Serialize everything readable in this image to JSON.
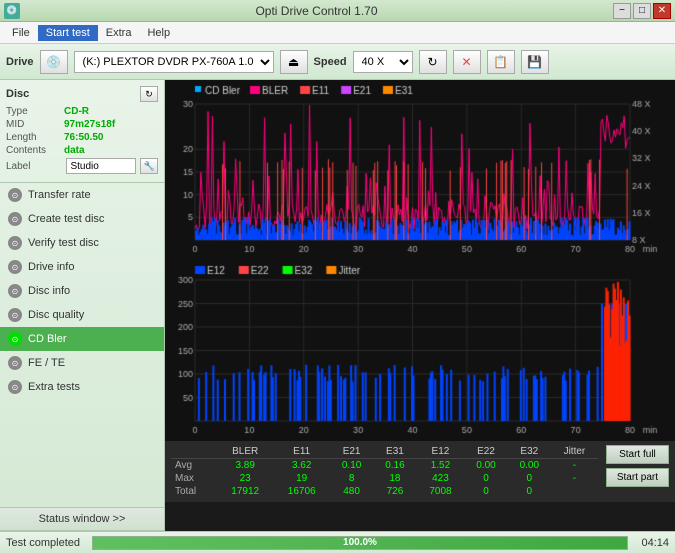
{
  "window": {
    "title": "Opti Drive Control 1.70",
    "icon": "💿"
  },
  "titlebar_buttons": {
    "minimize": "−",
    "maximize": "□",
    "close": "✕"
  },
  "menubar": {
    "items": [
      "File",
      "Start test",
      "Extra",
      "Help"
    ]
  },
  "toolbar": {
    "drive_label": "Drive",
    "drive_value": "(K:)  PLEXTOR DVDR  PX-760A 1.07",
    "speed_label": "Speed",
    "speed_value": "40 X"
  },
  "disc": {
    "title": "Disc",
    "type_label": "Type",
    "type_value": "CD-R",
    "mid_label": "MID",
    "mid_value": "97m27s18f",
    "length_label": "Length",
    "length_value": "76:50.50",
    "contents_label": "Contents",
    "contents_value": "data",
    "label_label": "Label",
    "label_value": "Studio"
  },
  "sidebar_items": [
    {
      "id": "transfer-rate",
      "label": "Transfer rate",
      "active": false
    },
    {
      "id": "create-test-disc",
      "label": "Create test disc",
      "active": false
    },
    {
      "id": "verify-test-disc",
      "label": "Verify test disc",
      "active": false
    },
    {
      "id": "drive-info",
      "label": "Drive info",
      "active": false
    },
    {
      "id": "disc-info",
      "label": "Disc info",
      "active": false
    },
    {
      "id": "disc-quality",
      "label": "Disc quality",
      "active": false
    },
    {
      "id": "cd-bler",
      "label": "CD Bler",
      "active": true
    },
    {
      "id": "fe-te",
      "label": "FE / TE",
      "active": false
    },
    {
      "id": "extra-tests",
      "label": "Extra tests",
      "active": false
    }
  ],
  "status_window_btn": "Status window >>",
  "chart1": {
    "title": "CD Bler",
    "legend": [
      {
        "label": "BLER",
        "color": "#ff0080"
      },
      {
        "label": "E11",
        "color": "#ff4444"
      },
      {
        "label": "E21",
        "color": "#cc44ff"
      },
      {
        "label": "E31",
        "color": "#ff8800"
      }
    ],
    "y_max": 30,
    "y_labels": [
      "30",
      "20",
      "15",
      "10",
      "5"
    ],
    "x_max": 80,
    "right_labels": [
      "48 X",
      "40 X",
      "32 X",
      "24 X",
      "16 X",
      "8 X"
    ],
    "x_unit": "min"
  },
  "chart2": {
    "legend": [
      {
        "label": "E12",
        "color": "#00aaff"
      },
      {
        "label": "E22",
        "color": "#ff4444"
      },
      {
        "label": "E32",
        "color": "#00ff00"
      },
      {
        "label": "Jitter",
        "color": "#ff8800"
      }
    ],
    "y_max": 300,
    "y_labels": [
      "300",
      "250",
      "200",
      "150",
      "100",
      "50"
    ],
    "x_max": 80,
    "x_unit": "min"
  },
  "stats": {
    "columns": [
      "",
      "BLER",
      "E11",
      "E21",
      "E31",
      "E12",
      "E22",
      "E32",
      "Jitter"
    ],
    "rows": [
      {
        "label": "Avg",
        "values": [
          "3.89",
          "3.62",
          "0.10",
          "0.16",
          "1.52",
          "0.00",
          "0.00",
          "-"
        ]
      },
      {
        "label": "Max",
        "values": [
          "23",
          "19",
          "8",
          "18",
          "423",
          "0",
          "0",
          "-"
        ]
      },
      {
        "label": "Total",
        "values": [
          "17912",
          "16706",
          "480",
          "726",
          "7008",
          "0",
          "0",
          ""
        ]
      }
    ],
    "btn_full": "Start full",
    "btn_part": "Start part"
  },
  "progress": {
    "status": "Test completed",
    "percent": "100.0%",
    "time": "04:14"
  }
}
